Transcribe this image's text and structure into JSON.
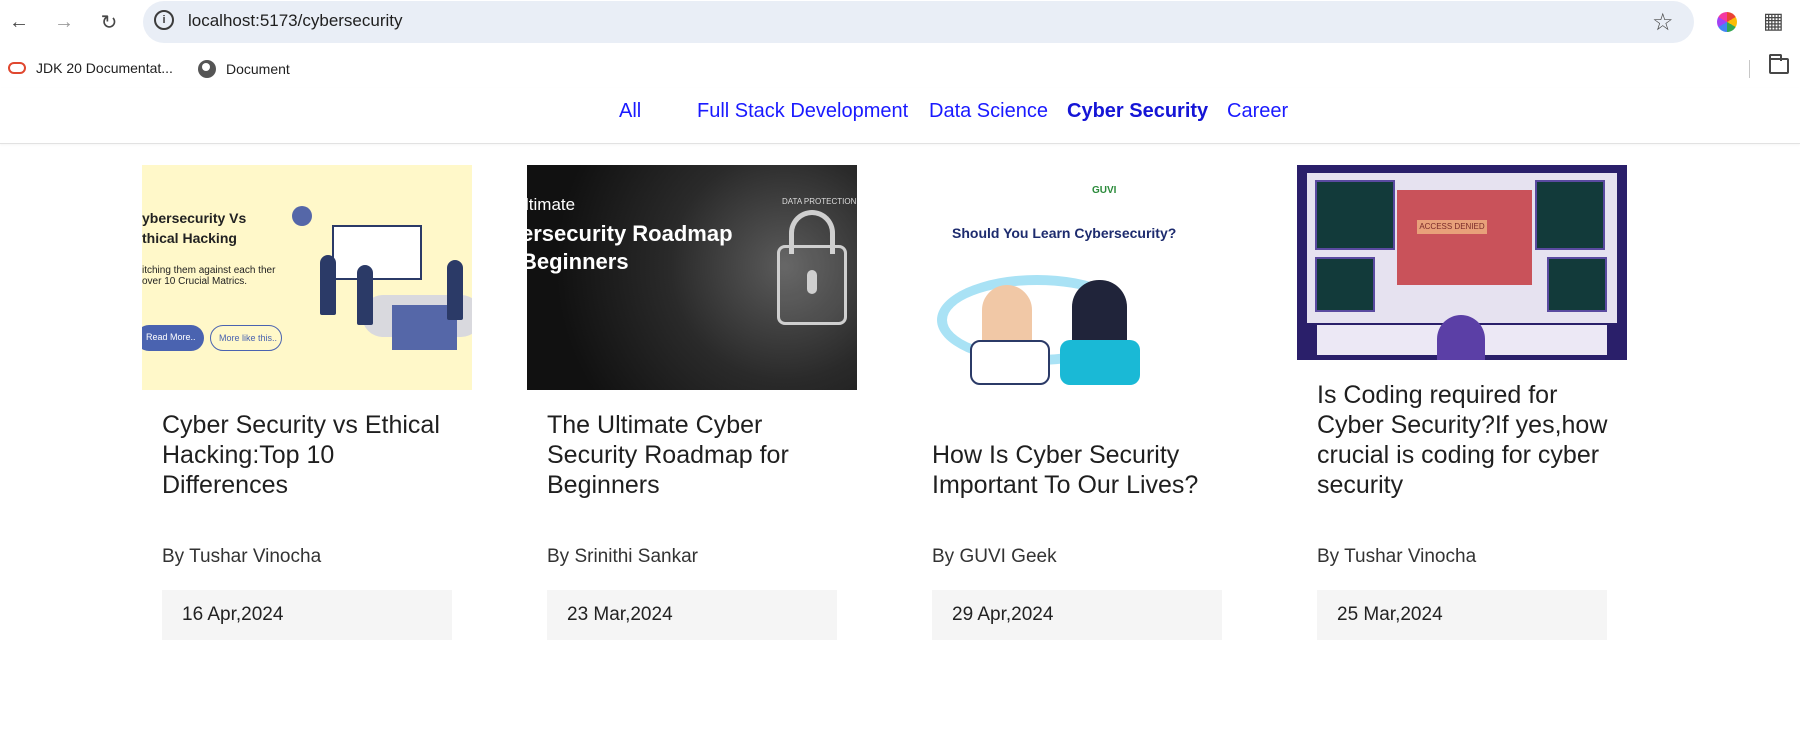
{
  "browser": {
    "url": "localhost:5173/cybersecurity",
    "bookmarks": [
      {
        "label": "JDK 20 Documentat..."
      },
      {
        "label": "Document"
      }
    ]
  },
  "nav": {
    "categories": [
      {
        "label": "All",
        "active": false
      },
      {
        "label": "Full Stack Development",
        "active": false
      },
      {
        "label": "Data Science",
        "active": false
      },
      {
        "label": "Cyber Security",
        "active": true
      },
      {
        "label": "Career",
        "active": false
      }
    ]
  },
  "cards": [
    {
      "title": "Cyber Security vs Ethical Hacking:Top 10 Differences",
      "author": "By Tushar Vinocha",
      "date": "16 Apr,2024",
      "thumb": {
        "line1": "ybersecurity Vs",
        "line2": "thical Hacking",
        "line3": "itching them against each ther over 10 Crucial Matrics.",
        "btn1": "Read More..",
        "btn2": "More like this.."
      }
    },
    {
      "title": "The Ultimate Cyber Security Roadmap for Beginners",
      "author": "By Srinithi Sankar",
      "date": "23 Mar,2024",
      "thumb": {
        "line1": "ltimate",
        "line2": "ersecurity Roadmap",
        "line3": "Beginners",
        "tag": "DATA PROTECTION"
      }
    },
    {
      "title": "How Is Cyber Security Important To Our Lives?",
      "author": "By GUVI Geek",
      "date": "29 Apr,2024",
      "thumb": {
        "question": "Should You Learn Cybersecurity?",
        "logo": "GUVI"
      }
    },
    {
      "title": "Is Coding required for Cyber Security?If yes,how crucial is coding for cyber security",
      "author": "By Tushar Vinocha",
      "date": "25 Mar,2024",
      "thumb": {
        "banner": "ACCESS DENIED"
      }
    }
  ]
}
